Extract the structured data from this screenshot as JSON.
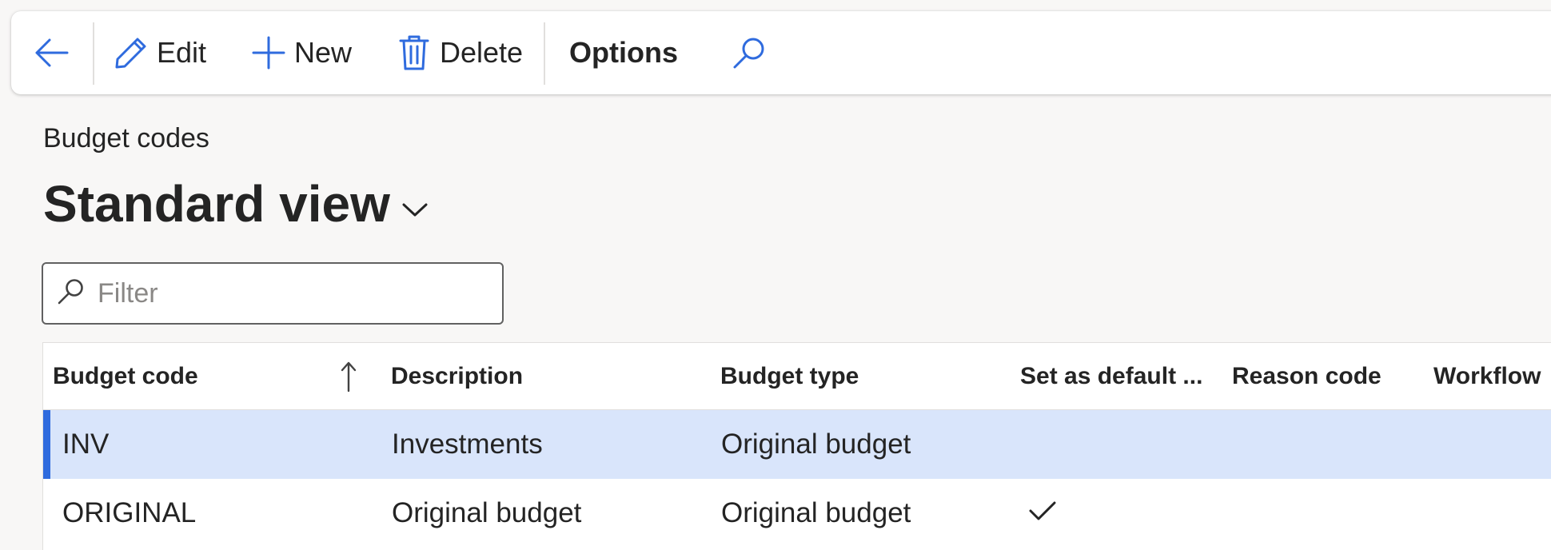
{
  "toolbar": {
    "back_icon": "arrow-left-icon",
    "edit_label": "Edit",
    "new_label": "New",
    "delete_label": "Delete",
    "options_label": "Options",
    "search_icon": "search-icon"
  },
  "breadcrumb": "Budget codes",
  "view": {
    "title": "Standard view",
    "chevron_icon": "chevron-down-icon"
  },
  "filter": {
    "placeholder": "Filter",
    "value": ""
  },
  "grid": {
    "columns": [
      "Budget code",
      "Description",
      "Budget type",
      "Set as default ...",
      "Reason code",
      "Workflow"
    ],
    "sort": {
      "column": "Budget code",
      "direction": "ascending"
    },
    "rows": [
      {
        "budget_code": "INV",
        "description": "Investments",
        "budget_type": "Original budget",
        "set_as_default": false,
        "reason_code": "",
        "workflow": "",
        "selected": true
      },
      {
        "budget_code": "ORIGINAL",
        "description": "Original budget",
        "budget_type": "Original budget",
        "set_as_default": true,
        "reason_code": "",
        "workflow": "",
        "selected": false
      }
    ]
  },
  "colors": {
    "accent": "#2f6bde",
    "selected_row": "#d9e5fb",
    "background": "#f8f7f6"
  }
}
